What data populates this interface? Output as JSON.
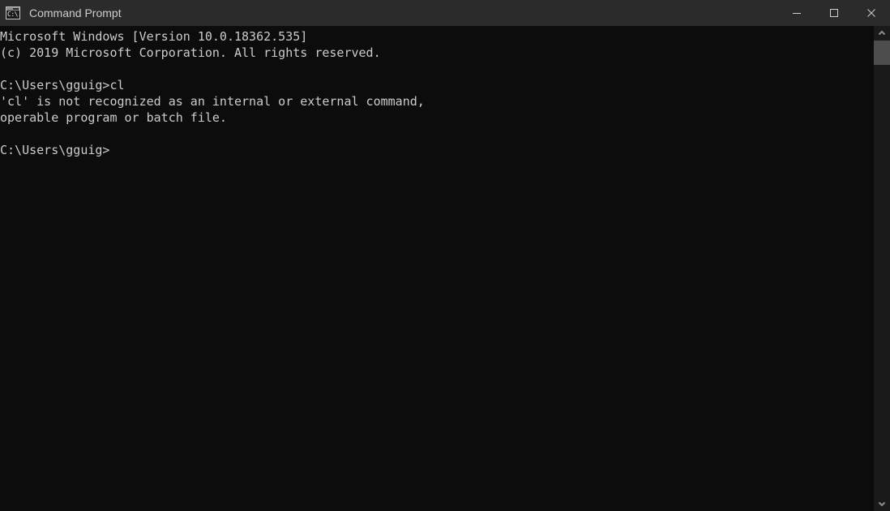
{
  "window": {
    "title": "Command Prompt",
    "icon_name": "cmd-icon",
    "icon_text": "C:\\.",
    "background_color": "#0c0c0c",
    "titlebar_color": "#2b2b2b",
    "text_color": "#cccccc"
  },
  "controls": {
    "minimize_label": "Minimize",
    "maximize_label": "Maximize",
    "close_label": "Close"
  },
  "console": {
    "lines": [
      "Microsoft Windows [Version 10.0.18362.535]",
      "(c) 2019 Microsoft Corporation. All rights reserved.",
      "",
      "C:\\Users\\gguig>cl",
      "'cl' is not recognized as an internal or external command,",
      "operable program or batch file.",
      "",
      "C:\\Users\\gguig>"
    ],
    "content": "Microsoft Windows [Version 10.0.18362.535]\n(c) 2019 Microsoft Corporation. All rights reserved.\n\nC:\\Users\\gguig>cl\n'cl' is not recognized as an internal or external command,\noperable program or batch file.\n\nC:\\Users\\gguig>",
    "prompt": "C:\\Users\\gguig>",
    "last_command": "cl"
  },
  "scrollbar": {
    "up_arrow_name": "chevron-up-icon",
    "down_arrow_name": "chevron-down-icon",
    "thumb_color": "#4d4d4d",
    "track_color": "#1a1a1a"
  }
}
